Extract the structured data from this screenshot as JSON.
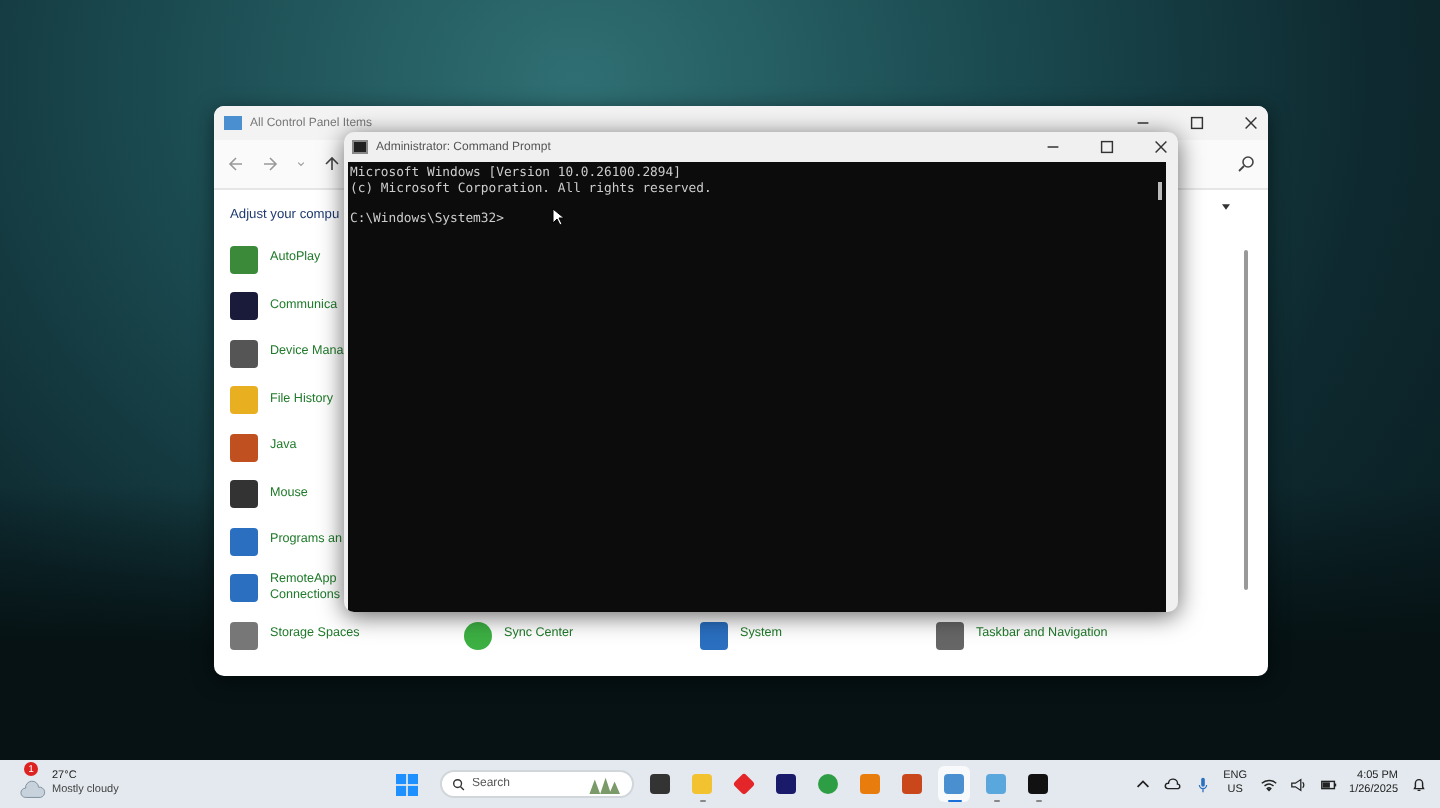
{
  "control_panel": {
    "title": "All Control Panel Items",
    "heading": "Adjust your compu",
    "items": [
      {
        "label": "AutoPlay"
      },
      {
        "label": "Communica"
      },
      {
        "label": "Device Mana"
      },
      {
        "label": "File History"
      },
      {
        "label": "Java"
      },
      {
        "label": "Mouse"
      },
      {
        "label": "Programs an"
      },
      {
        "label": "RemoteApp",
        "label_2": "Connections"
      },
      {
        "label": "Storage Spaces"
      }
    ],
    "bottom_items": [
      {
        "label": "Sync Center"
      },
      {
        "label": "System"
      },
      {
        "label": "Taskbar and Navigation"
      }
    ]
  },
  "command_prompt": {
    "title": "Administrator: Command Prompt",
    "lines": [
      "Microsoft Windows [Version 10.0.26100.2894]",
      "(c) Microsoft Corporation. All rights reserved.",
      "C:\\Windows\\System32>"
    ]
  },
  "taskbar": {
    "weather": {
      "temperature": "27°C",
      "condition": "Mostly cloudy",
      "badge": "1"
    },
    "search": {
      "placeholder": "Search"
    },
    "apps": [
      {
        "kind": "taskview",
        "running": false,
        "selected": false
      },
      {
        "kind": "folder",
        "running": true,
        "selected": false
      },
      {
        "kind": "diamond",
        "running": false,
        "selected": false
      },
      {
        "kind": "premiere",
        "running": false,
        "selected": false
      },
      {
        "kind": "chrome",
        "running": false,
        "selected": false
      },
      {
        "kind": "blender",
        "running": false,
        "selected": false
      },
      {
        "kind": "matlab",
        "running": false,
        "selected": false
      },
      {
        "kind": "controlpanel",
        "running": true,
        "selected": true
      },
      {
        "kind": "monitor",
        "running": true,
        "selected": false
      },
      {
        "kind": "terminal",
        "running": true,
        "selected": false
      }
    ],
    "language": "ENG",
    "region": "US",
    "time": "4:05 PM",
    "date": "1/26/2025"
  }
}
